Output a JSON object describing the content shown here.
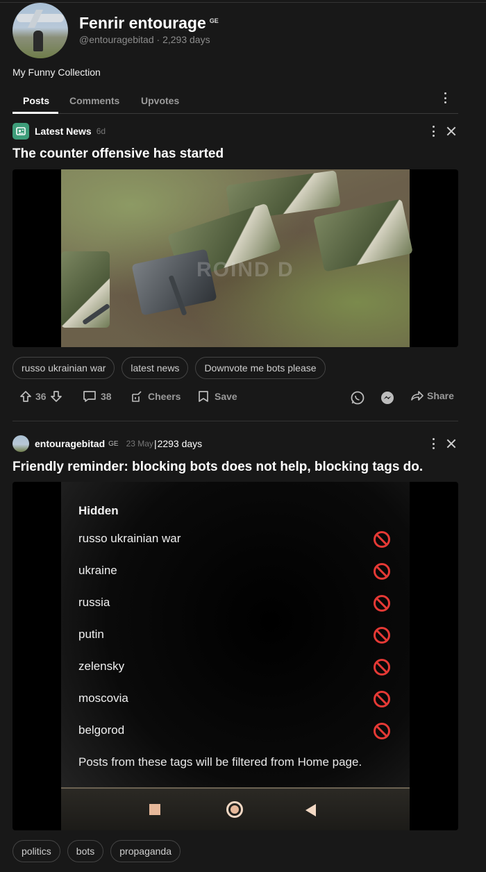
{
  "profile": {
    "name": "Fenrir entourage",
    "country_badge": "GE",
    "handle_line": "@entouragebitad · 2,293 days",
    "bio": "My Funny Collection"
  },
  "tabs": [
    {
      "label": "Posts",
      "active": true
    },
    {
      "label": "Comments",
      "active": false
    },
    {
      "label": "Upvotes",
      "active": false
    }
  ],
  "post1": {
    "section": "Latest News",
    "time": "6d",
    "title": "The counter offensive has started",
    "image_watermark": "ROIND D",
    "tags": [
      "russo ukrainian war",
      "latest news",
      "Downvote me bots please"
    ],
    "upvotes": "36",
    "comments": "38",
    "cheers_label": "Cheers",
    "save_label": "Save",
    "share_label": "Share"
  },
  "post2": {
    "username": "entouragebitad",
    "country_badge": "GE",
    "date": "23 May",
    "days": "2293 days",
    "title": "Friendly reminder: blocking bots does not help, blocking tags do.",
    "screenshot": {
      "heading": "Hidden",
      "hidden_tags": [
        "russo ukrainian war",
        "ukraine",
        "russia",
        "putin",
        "zelensky",
        "moscovia",
        "belgorod"
      ],
      "note": "Posts from these tags will be filtered from Home page."
    },
    "tags": [
      "politics",
      "bots",
      "propaganda"
    ]
  },
  "colors": {
    "background": "#181818",
    "accent_section": "#3e9d7a",
    "block_red": "#e53935"
  }
}
